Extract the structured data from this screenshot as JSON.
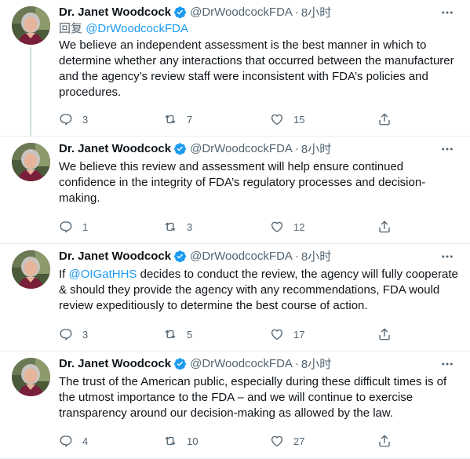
{
  "colors": {
    "accent": "#1d9bf0",
    "muted": "#536471",
    "text": "#0f1419",
    "border": "#e6ecf0"
  },
  "tweets": [
    {
      "name": "Dr. Janet Woodcock",
      "handle": "@DrWoodcockFDA",
      "dot": "·",
      "time": "8小时",
      "reply_label": "回复",
      "reply_handle": "@DrWoodcockFDA",
      "text": "We believe an independent assessment is the best manner in which to determine whether any interactions that occurred between the manufacturer and the agency’s review staff were inconsistent with FDA’s policies and procedures.",
      "replies": "3",
      "retweets": "7",
      "likes": "15"
    },
    {
      "name": "Dr. Janet Woodcock",
      "handle": "@DrWoodcockFDA",
      "dot": "·",
      "time": "8小时",
      "text": "We believe this review and assessment will help ensure continued confidence in the integrity of FDA’s regulatory processes and decision-making.",
      "replies": "1",
      "retweets": "3",
      "likes": "12"
    },
    {
      "name": "Dr. Janet Woodcock",
      "handle": "@DrWoodcockFDA",
      "dot": "·",
      "time": "8小时",
      "text_prefix": "If ",
      "mention": "@OIGatHHS",
      "text_suffix": " decides to conduct the review, the agency will fully cooperate & should they provide the agency with any recommendations, FDA would review expeditiously to determine the best course of action.",
      "replies": "3",
      "retweets": "5",
      "likes": "17"
    },
    {
      "name": "Dr. Janet Woodcock",
      "handle": "@DrWoodcockFDA",
      "dot": "·",
      "time": "8小时",
      "text": "The trust of the American public, especially during these difficult times is of the utmost importance to the FDA – and we will continue to exercise transparency around our decision-making as allowed by the law.",
      "replies": "4",
      "retweets": "10",
      "likes": "27"
    }
  ]
}
